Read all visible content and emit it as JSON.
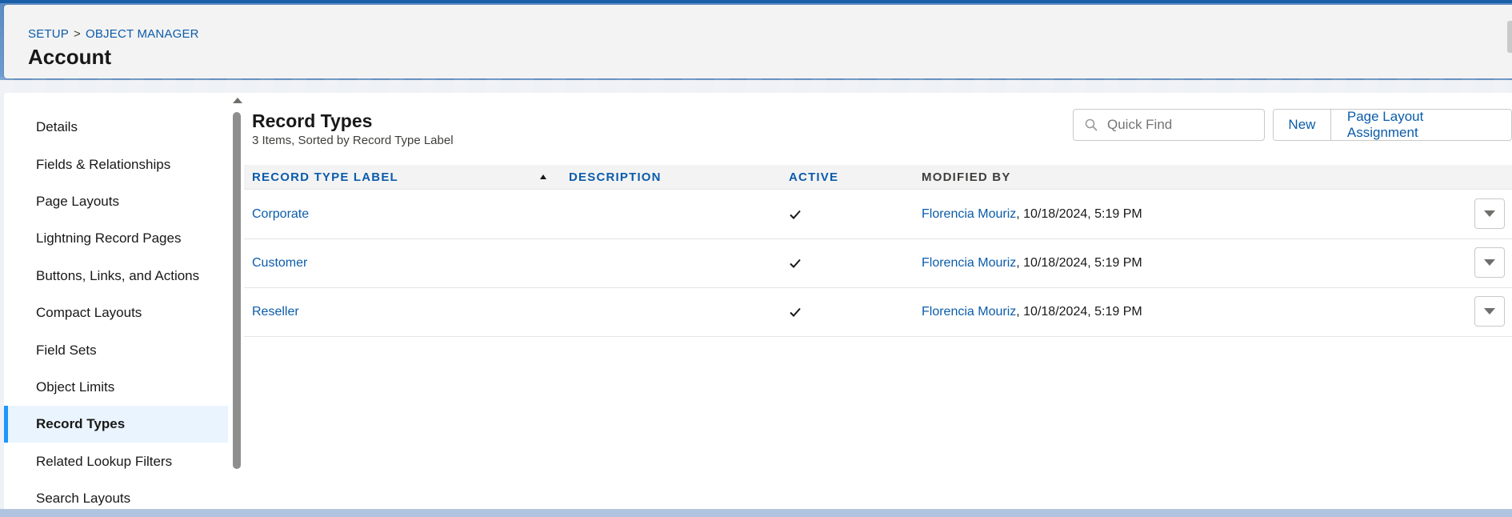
{
  "header": {
    "breadcrumb": [
      "SETUP",
      "OBJECT MANAGER"
    ],
    "breadcrumb_separator": ">",
    "title": "Account"
  },
  "sidebar": {
    "items": [
      {
        "label": "Details",
        "active": false
      },
      {
        "label": "Fields & Relationships",
        "active": false
      },
      {
        "label": "Page Layouts",
        "active": false
      },
      {
        "label": "Lightning Record Pages",
        "active": false
      },
      {
        "label": "Buttons, Links, and Actions",
        "active": false
      },
      {
        "label": "Compact Layouts",
        "active": false
      },
      {
        "label": "Field Sets",
        "active": false
      },
      {
        "label": "Object Limits",
        "active": false
      },
      {
        "label": "Record Types",
        "active": true
      },
      {
        "label": "Related Lookup Filters",
        "active": false
      },
      {
        "label": "Search Layouts",
        "active": false
      }
    ]
  },
  "main": {
    "title": "Record Types",
    "subtitle": "3 Items, Sorted by Record Type Label",
    "quick_find_placeholder": "Quick Find",
    "buttons": {
      "new": "New",
      "page_layout_assignment": "Page Layout Assignment"
    },
    "columns": {
      "label": "RECORD TYPE LABEL",
      "description": "DESCRIPTION",
      "active": "ACTIVE",
      "modified_by": "MODIFIED BY"
    },
    "rows": [
      {
        "label": "Corporate",
        "description": "",
        "active": true,
        "modified_by_user": "Florencia Mouriz",
        "modified_date": ", 10/18/2024, 5:19 PM"
      },
      {
        "label": "Customer",
        "description": "",
        "active": true,
        "modified_by_user": "Florencia Mouriz",
        "modified_date": ", 10/18/2024, 5:19 PM"
      },
      {
        "label": "Reseller",
        "description": "",
        "active": true,
        "modified_by_user": "Florencia Mouriz",
        "modified_date": ", 10/18/2024, 5:19 PM"
      }
    ]
  },
  "colors": {
    "link": "#0b5cab",
    "active_nav_bg": "#eaf4fe",
    "active_nav_bar": "#1b96ff",
    "brand_blue": "#1b5fa8"
  }
}
